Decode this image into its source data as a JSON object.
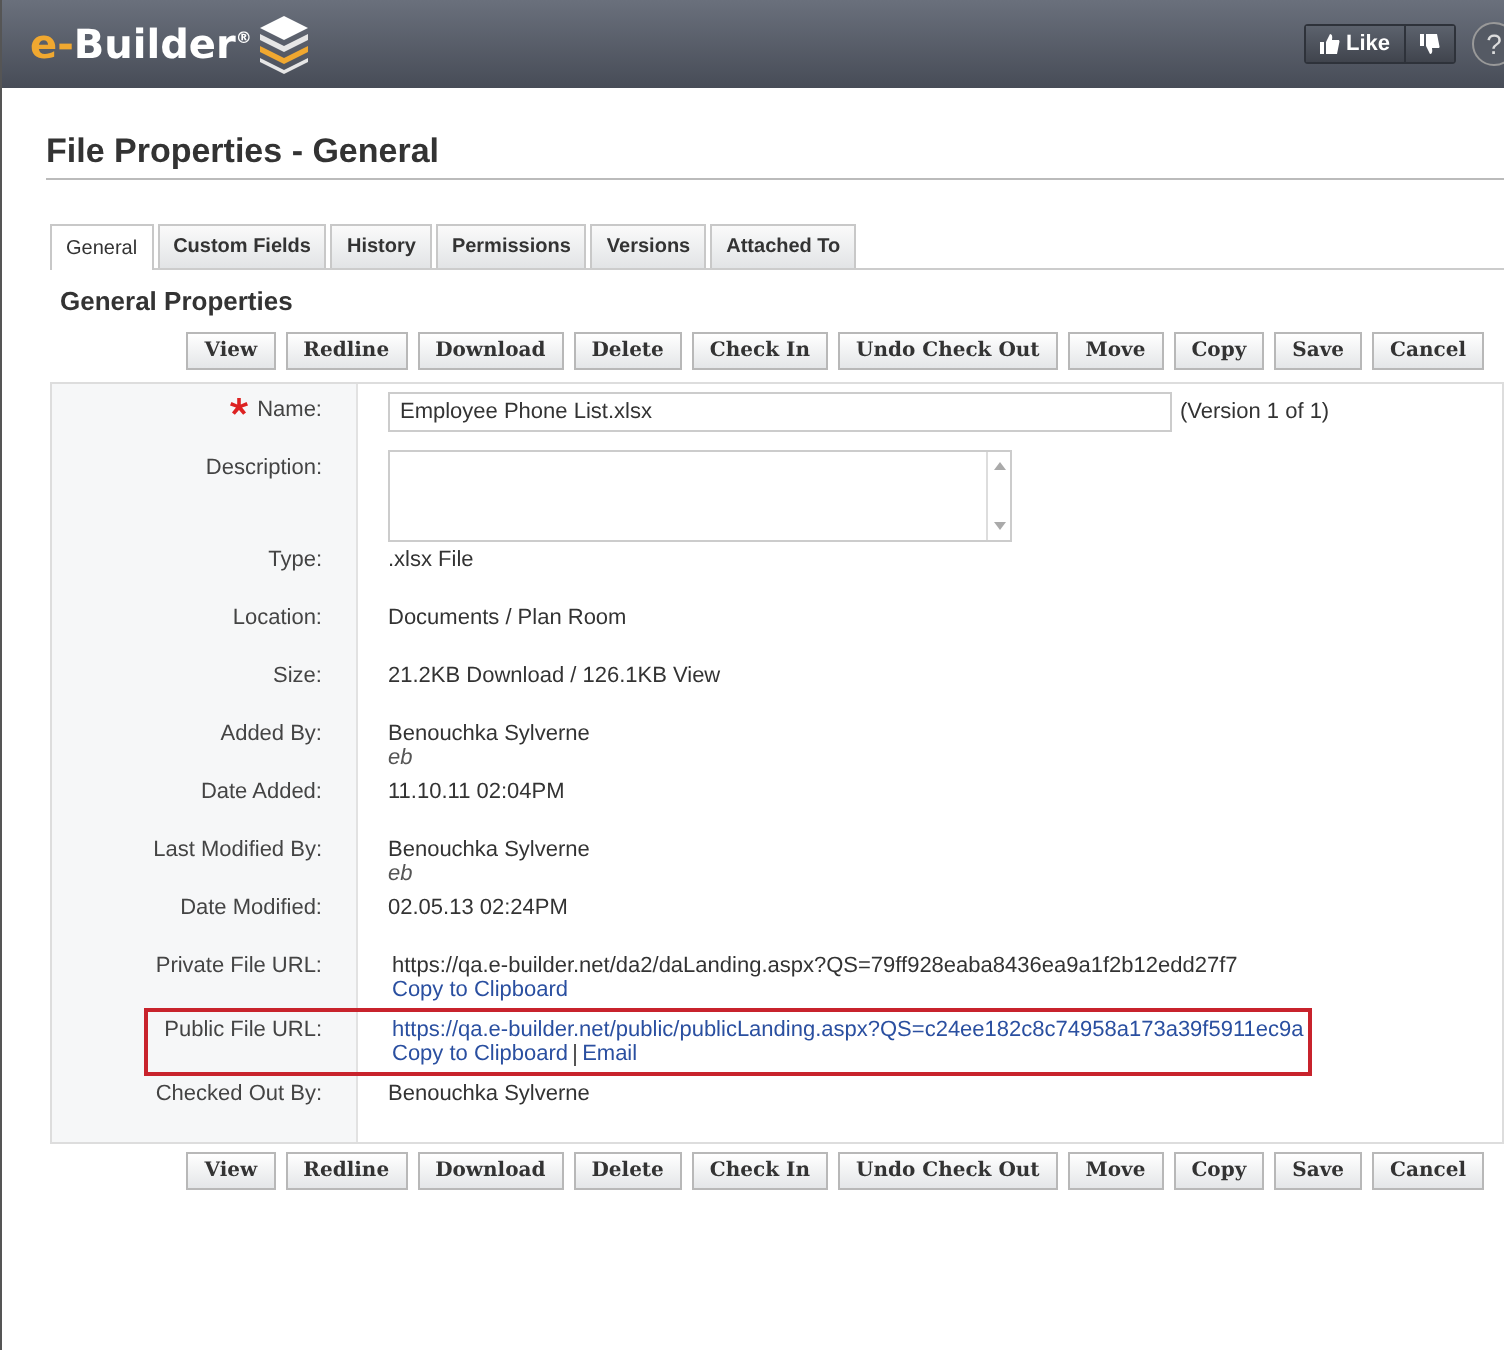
{
  "header": {
    "logo": {
      "accent": "e-",
      "text": "Builder",
      "mark": "®"
    },
    "like": "Like",
    "help": "?"
  },
  "title": "File Properties - General",
  "tabs": [
    {
      "label": "General",
      "selected": true
    },
    {
      "label": "Custom Fields",
      "selected": false
    },
    {
      "label": "History",
      "selected": false
    },
    {
      "label": "Permissions",
      "selected": false
    },
    {
      "label": "Versions",
      "selected": false
    },
    {
      "label": "Attached To",
      "selected": false
    }
  ],
  "section": "General Properties",
  "toolbar_top": [
    "View",
    "Redline",
    "Download",
    "Delete",
    "Check In",
    "Undo Check Out",
    "Move",
    "Copy",
    "Save",
    "Cancel"
  ],
  "fields": [
    {
      "kind": "input",
      "label": "Name:",
      "required": true,
      "value": "Employee Phone List.xlsx",
      "note": "(Version 1 of 1)"
    },
    {
      "kind": "textarea",
      "label": "Description:",
      "required": false
    },
    {
      "kind": "text",
      "label": "Type:",
      "required": false,
      "value": ".xlsx File"
    },
    {
      "kind": "text",
      "label": "Location:",
      "required": false,
      "value": "Documents / Plan Room"
    },
    {
      "kind": "text",
      "label": "Size:",
      "required": false,
      "value": "21.2KB Download / 126.1KB View"
    },
    {
      "kind": "person",
      "label": "Added By:",
      "required": false,
      "value": "Benouchka Sylverne",
      "sub": "eb"
    },
    {
      "kind": "text",
      "label": "Date Added:",
      "required": false,
      "value": "11.10.11 02:04PM"
    },
    {
      "kind": "person",
      "label": "Last Modified By:",
      "required": false,
      "value": "Benouchka Sylverne",
      "sub": "eb"
    },
    {
      "kind": "text",
      "label": "Date Modified:",
      "required": false,
      "value": "02.05.13 02:24PM"
    },
    {
      "kind": "url",
      "label": "Private File URL:",
      "required": false,
      "value": "https://qa.e-builder.net/da2/daLanding.aspx?QS=79ff928eaba8436ea9a1f2b12edd27f7",
      "is_link": false,
      "highlighted": false,
      "actions": [
        "Copy to Clipboard"
      ]
    },
    {
      "kind": "url",
      "label": "Public File URL:",
      "required": false,
      "value": "https://qa.e-builder.net/public/publicLanding.aspx?QS=c24ee182c8c74958a173a39f5911ec9a",
      "is_link": true,
      "highlighted": true,
      "actions": [
        "Copy to Clipboard",
        "Email"
      ]
    },
    {
      "kind": "text",
      "label": "Checked Out By:",
      "required": false,
      "value": "Benouchka Sylverne"
    }
  ],
  "toolbar_bottom": [
    "View",
    "Redline",
    "Download",
    "Delete",
    "Check In",
    "Undo Check Out",
    "Move",
    "Copy",
    "Save",
    "Cancel"
  ]
}
